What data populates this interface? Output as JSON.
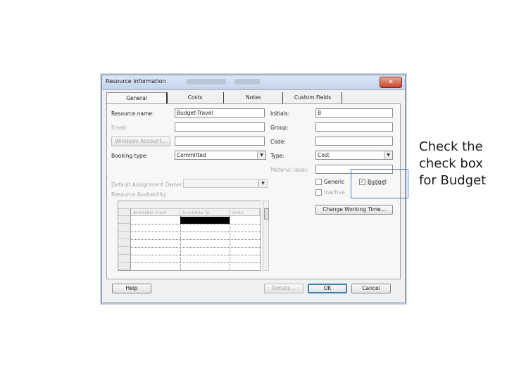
{
  "window": {
    "title": "Resource Information",
    "close_label": "✕"
  },
  "tabs": [
    {
      "label": "General"
    },
    {
      "label": "Costs"
    },
    {
      "label": "Notes"
    },
    {
      "label": "Custom Fields"
    }
  ],
  "form": {
    "resource_name_label": "Resource name:",
    "resource_name_value": "Budget-Travel",
    "email_label": "Email:",
    "email_value": "",
    "windows_account_label": "Windows Account...",
    "booking_type_label": "Booking type:",
    "booking_type_value": "Committed",
    "default_owner_label": "Default Assignment Owner:",
    "default_owner_value": "",
    "availability_label": "Resource Availability",
    "initials_label": "Initials:",
    "initials_value": "B",
    "group_label": "Group:",
    "group_value": "",
    "code_label": "Code:",
    "code_value": "",
    "type_label": "Type:",
    "type_value": "Cost",
    "material_label_label": "Material label:",
    "material_label_value": "",
    "generic_label": "Generic",
    "generic_checked": false,
    "budget_label": "Budget",
    "budget_checked": true,
    "inactive_label": "Inactive",
    "inactive_checked": false,
    "change_working_time_label": "Change Working Time..."
  },
  "availability_grid": {
    "columns": [
      "Available From",
      "Available To",
      "Units"
    ]
  },
  "footer": {
    "help_label": "Help",
    "details_label": "Details...",
    "ok_label": "OK",
    "cancel_label": "Cancel"
  },
  "callout": {
    "text": "Check the check box for Budget"
  },
  "colors": {
    "accent": "#4a7fc0",
    "close_button": "#c7422a"
  }
}
